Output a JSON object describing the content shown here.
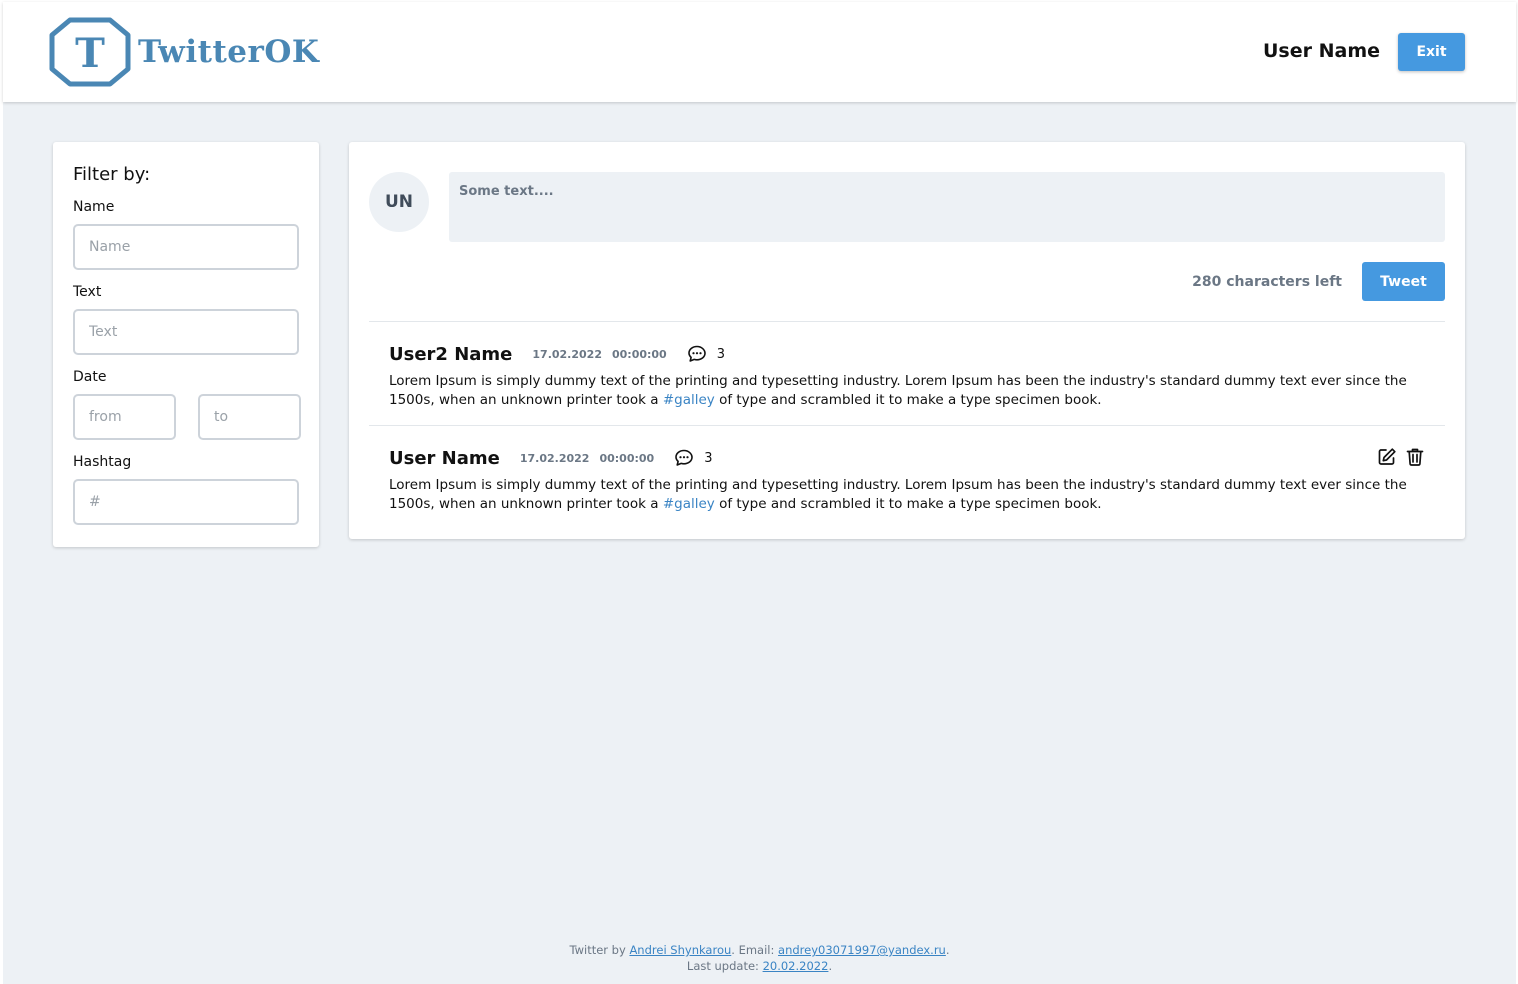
{
  "header": {
    "logo_letter": "T",
    "logo_text": "TwitterOK",
    "user_name": "User Name",
    "exit_label": "Exit"
  },
  "filter": {
    "title": "Filter by:",
    "name_label": "Name",
    "name_placeholder": "Name",
    "text_label": "Text",
    "text_placeholder": "Text",
    "date_label": "Date",
    "from_placeholder": "from",
    "to_placeholder": "to",
    "hashtag_label": "Hashtag",
    "hashtag_placeholder": "#"
  },
  "composer": {
    "avatar_initials": "UN",
    "placeholder": "Some text....",
    "chars_left": "280 characters left",
    "tweet_label": "Tweet"
  },
  "tweets": [
    {
      "author": "User2 Name",
      "date": "17.02.2022",
      "time": "00:00:00",
      "comments": "3",
      "text_before": "Lorem Ipsum is simply dummy text of the printing and typesetting industry. Lorem Ipsum has been the industry's standard dummy text ever since the 1500s, when an unknown printer took a ",
      "hashtag": "#galley",
      "text_after": " of type and scrambled it to make a type specimen book.",
      "editable": false
    },
    {
      "author": "User Name",
      "date": "17.02.2022",
      "time": "00:00:00",
      "comments": "3",
      "text_before": "Lorem Ipsum is simply dummy text of the printing and typesetting industry. Lorem Ipsum has been the industry's standard dummy text ever since the 1500s, when an unknown printer took a ",
      "hashtag": "#galley",
      "text_after": " of type and scrambled it to make a type specimen book.",
      "editable": true
    }
  ],
  "footer": {
    "prefix": "Twitter by ",
    "author_link": "Andrei Shynkarou",
    "email_prefix": ". Email: ",
    "email_link": "andrey03071997@yandex.ru",
    "email_suffix": ".",
    "update_prefix": "Last update: ",
    "update_link": "20.02.2022",
    "update_suffix": "."
  },
  "colors": {
    "accent": "#4599e0",
    "logo": "#4a87b4",
    "background": "#edf1f5",
    "hashtag": "#3a84c4"
  },
  "icons": [
    "comment-icon",
    "edit-icon",
    "trash-icon"
  ]
}
